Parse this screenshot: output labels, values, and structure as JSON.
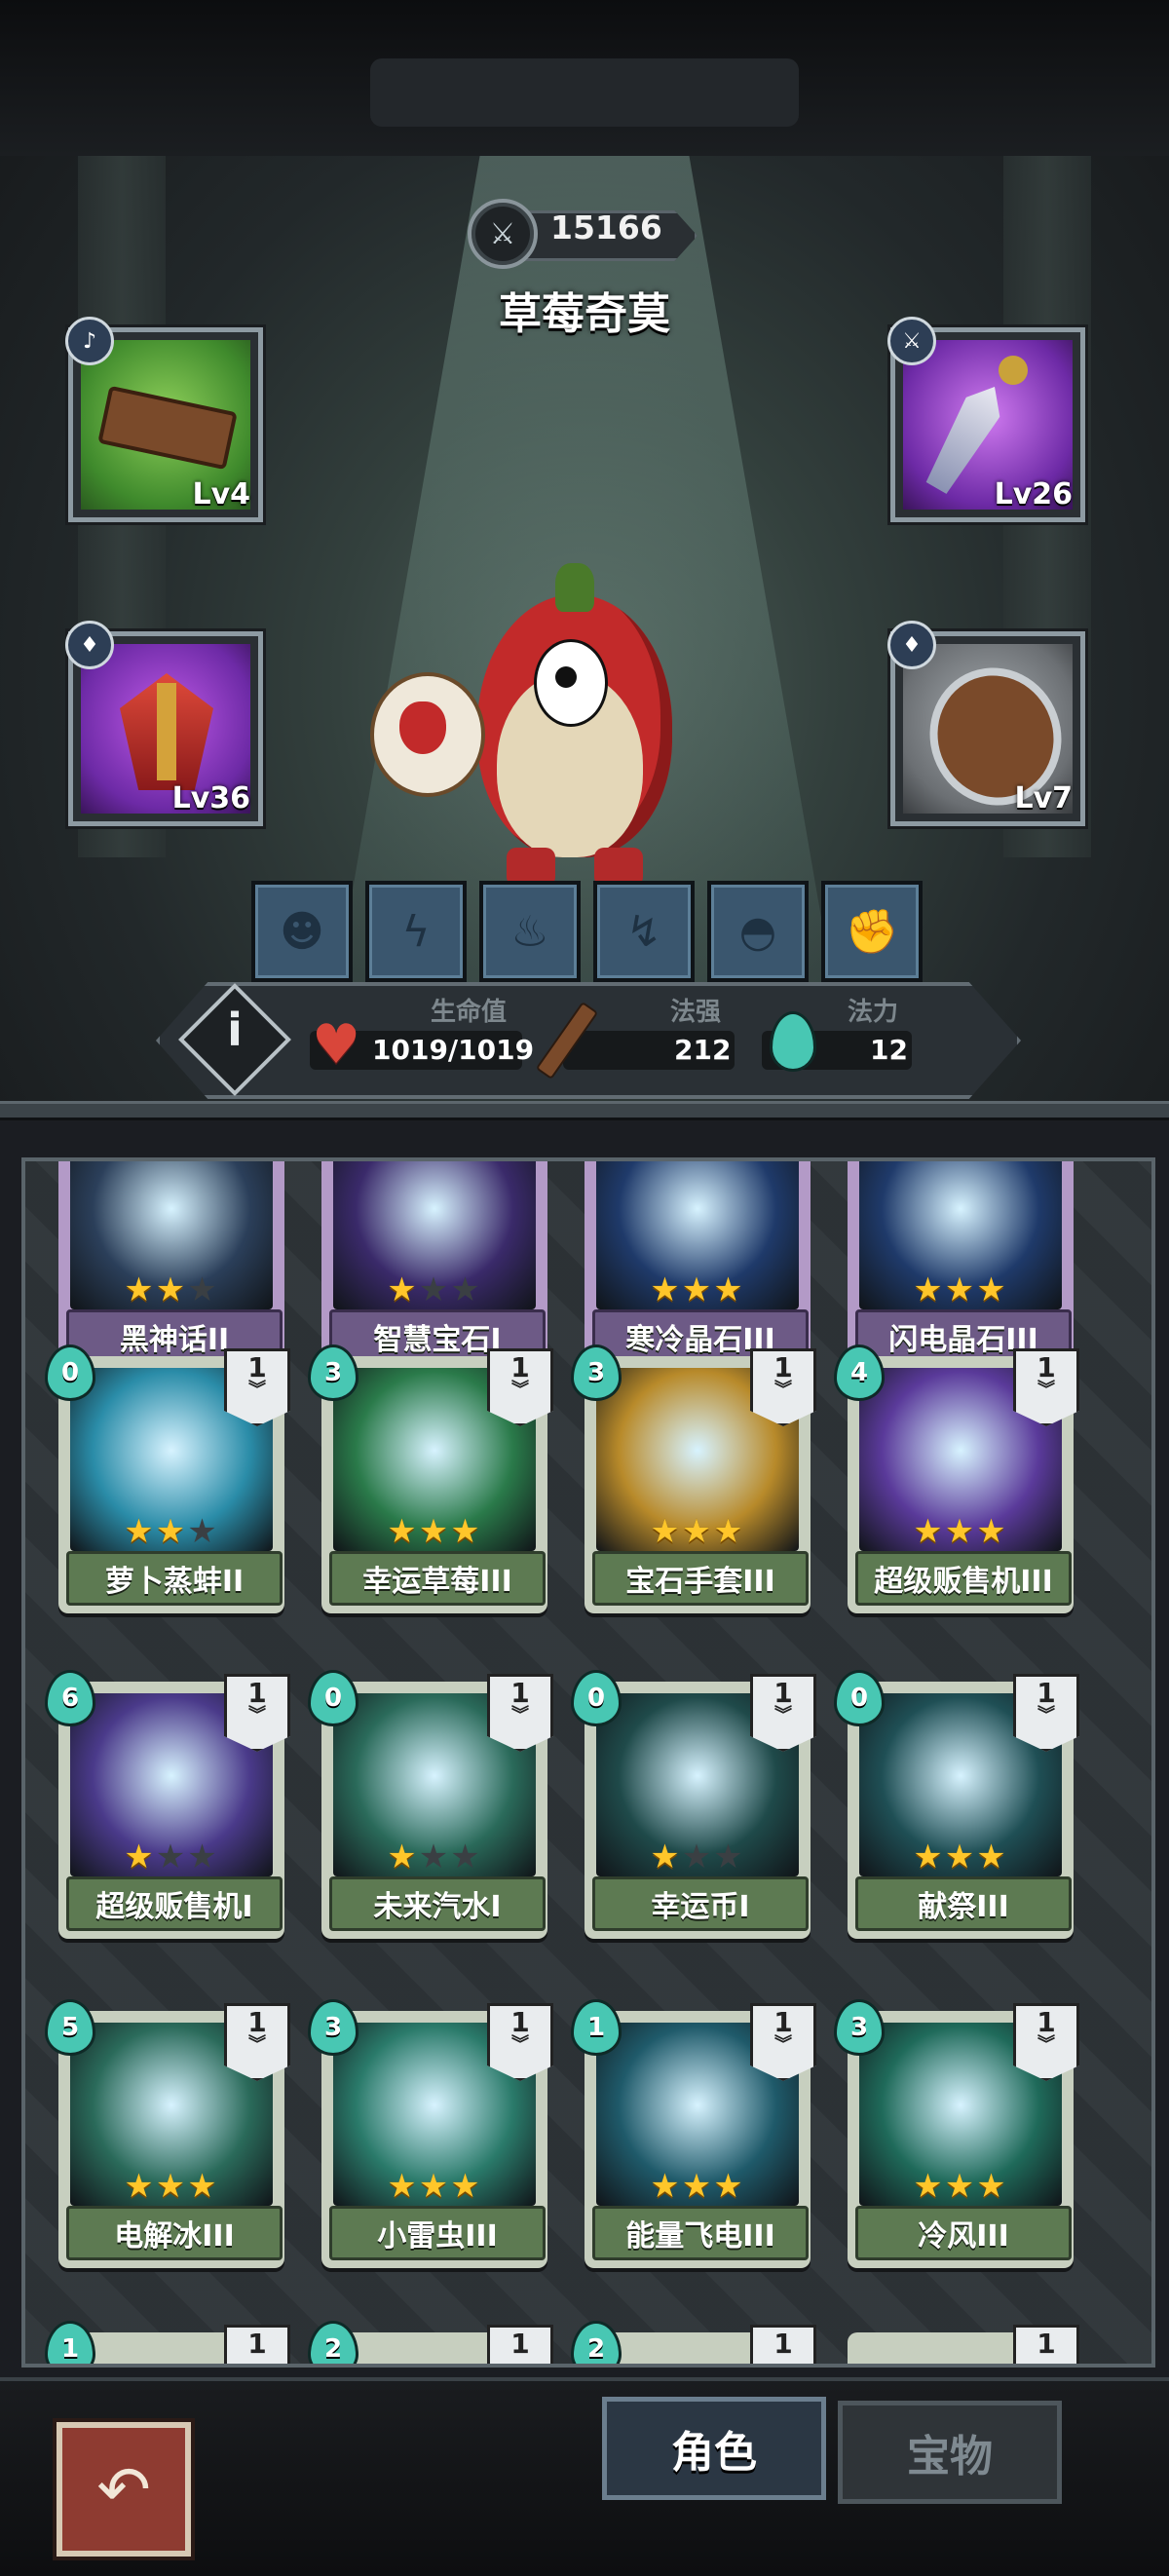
{
  "score": {
    "value": "15166",
    "icon": "swirl-sword-icon"
  },
  "hero": {
    "name": "草莓奇莫"
  },
  "equipment": [
    {
      "slot": "top-left",
      "level": "Lv4",
      "item_icon": "wooden-sandals-icon",
      "badge_icon": "boot-badge-icon",
      "color": "#3f8a2c"
    },
    {
      "slot": "top-right",
      "level": "Lv26",
      "item_icon": "jeweled-dagger-icon",
      "badge_icon": "sword-badge-icon",
      "color": "#6d2aa6"
    },
    {
      "slot": "bottom-left",
      "level": "Lv36",
      "item_icon": "winged-helmet-icon",
      "badge_icon": "armor-badge-icon",
      "color": "#6d2aa6"
    },
    {
      "slot": "bottom-right",
      "level": "Lv7",
      "item_icon": "wooden-shield-icon",
      "badge_icon": "armor-badge-icon",
      "color": "#6b6f73"
    }
  ],
  "skills": [
    "face-icon",
    "crack-icon",
    "pig-icon",
    "lightning-runner-icon",
    "bat-icon",
    "fist-icon"
  ],
  "stats": {
    "hp_label": "生命值",
    "hp_value": "1019/1019",
    "power_label": "法强",
    "power_value": "212",
    "mana_label": "法力",
    "mana_value": "12"
  },
  "cards": [
    {
      "name": "黑神话II",
      "stars": 2,
      "cost": "",
      "level": "",
      "style": "purple",
      "art_color": "#2b3f5a"
    },
    {
      "name": "智慧宝石I",
      "stars": 1,
      "cost": "",
      "level": "",
      "style": "purple",
      "art_color": "#3a2a6a"
    },
    {
      "name": "寒冷晶石III",
      "stars": 3,
      "cost": "",
      "level": "",
      "style": "purple",
      "art_color": "#1f3a6a"
    },
    {
      "name": "闪电晶石III",
      "stars": 3,
      "cost": "",
      "level": "",
      "style": "purple",
      "art_color": "#1f3a6a"
    },
    {
      "name": "萝卜蒸蚌II",
      "stars": 2,
      "cost": "0",
      "level": "1",
      "style": "green",
      "art_color": "#2a8ca8"
    },
    {
      "name": "幸运草莓III",
      "stars": 3,
      "cost": "3",
      "level": "1",
      "style": "green",
      "art_color": "#2a7a4a"
    },
    {
      "name": "宝石手套III",
      "stars": 3,
      "cost": "3",
      "level": "1",
      "style": "green",
      "art_color": "#b88a2a"
    },
    {
      "name": "超级贩售机III",
      "stars": 3,
      "cost": "4",
      "level": "1",
      "style": "green",
      "art_color": "#5a3a9a"
    },
    {
      "name": "超级贩售机I",
      "stars": 1,
      "cost": "6",
      "level": "1",
      "style": "green",
      "art_color": "#4a3a8a"
    },
    {
      "name": "未来汽水I",
      "stars": 1,
      "cost": "0",
      "level": "1",
      "style": "green",
      "art_color": "#2a6a5a"
    },
    {
      "name": "幸运币I",
      "stars": 1,
      "cost": "0",
      "level": "1",
      "style": "green",
      "art_color": "#1f4a4a"
    },
    {
      "name": "献祭III",
      "stars": 3,
      "cost": "0",
      "level": "1",
      "style": "green",
      "art_color": "#1f4f55"
    },
    {
      "name": "电解冰III",
      "stars": 3,
      "cost": "5",
      "level": "1",
      "style": "green",
      "art_color": "#2a6a5a"
    },
    {
      "name": "小雷虫III",
      "stars": 3,
      "cost": "3",
      "level": "1",
      "style": "green",
      "art_color": "#2a7a6a"
    },
    {
      "name": "能量飞电III",
      "stars": 3,
      "cost": "1",
      "level": "1",
      "style": "green",
      "art_color": "#1f5a6a"
    },
    {
      "name": "冷风III",
      "stars": 3,
      "cost": "3",
      "level": "1",
      "style": "green",
      "art_color": "#1f6a5a"
    }
  ],
  "partial_row_costs": [
    "1",
    "2",
    "2",
    ""
  ],
  "partial_row_levels": [
    "1",
    "1",
    "1",
    "1"
  ],
  "bottom": {
    "back_icon": "back-arrow-icon",
    "tab_role": "角色",
    "tab_treasure": "宝物"
  },
  "colors": {
    "accent_star": "#ffc62a",
    "mana_teal": "#48c7b3",
    "back_button": "#8e3b31"
  }
}
